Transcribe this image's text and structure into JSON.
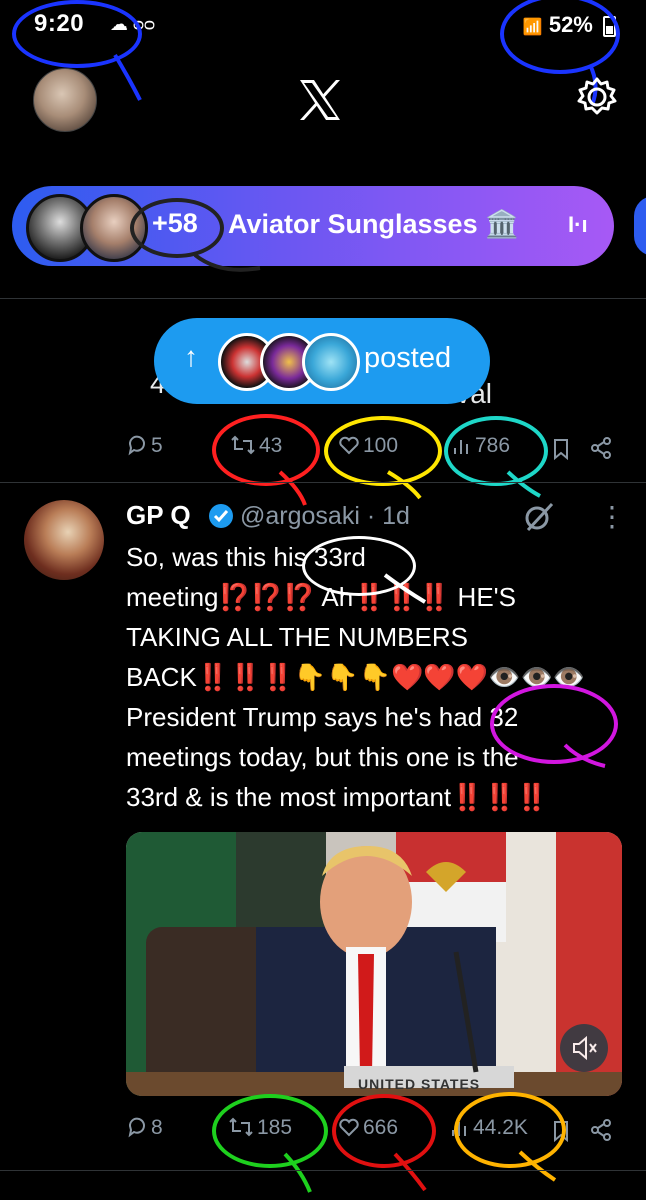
{
  "status_bar": {
    "time": "9:20",
    "left_icons": "☁ ᴑᴑ",
    "battery_pct": "52%"
  },
  "header": {
    "logo": "𝕏",
    "settings_icon": "gear-icon",
    "avatar_icon": "avatar"
  },
  "space": {
    "listener_count": "+58",
    "title": "Aviator Sunglasses 🏛️",
    "bars_icon": "I·ı"
  },
  "posted_pill": {
    "label": "posted",
    "arrow": "↑"
  },
  "prev_tweet": {
    "partial_left": "4",
    "partial_right": "ival",
    "replies": "5",
    "retweets": "43",
    "likes": "100",
    "views": "786"
  },
  "tweet": {
    "name": "GP Q",
    "handle": "@argosaki · 1d",
    "more_icon": "⋮",
    "body": "So, was this his 33rd\nmeeting⁉️⁉️⁉️ Ah‼️‼️‼️ HE'S\nTAKING ALL THE NUMBERS\nBACK‼️‼️‼️👇👇👇❤️❤️❤️👁️👁️👁️\nPresident Trump says he's had 32\nmeetings today, but this one is the\n33rd & is the most important‼️‼️‼️",
    "media_caption": "UNITED STATES",
    "replies": "8",
    "retweets": "185",
    "likes": "666",
    "views": "44.2K"
  },
  "colors": {
    "space_start": "#2d5cf0",
    "space_end": "#a759f5",
    "pill": "#1d9bf0",
    "muted": "#8b98a5"
  }
}
